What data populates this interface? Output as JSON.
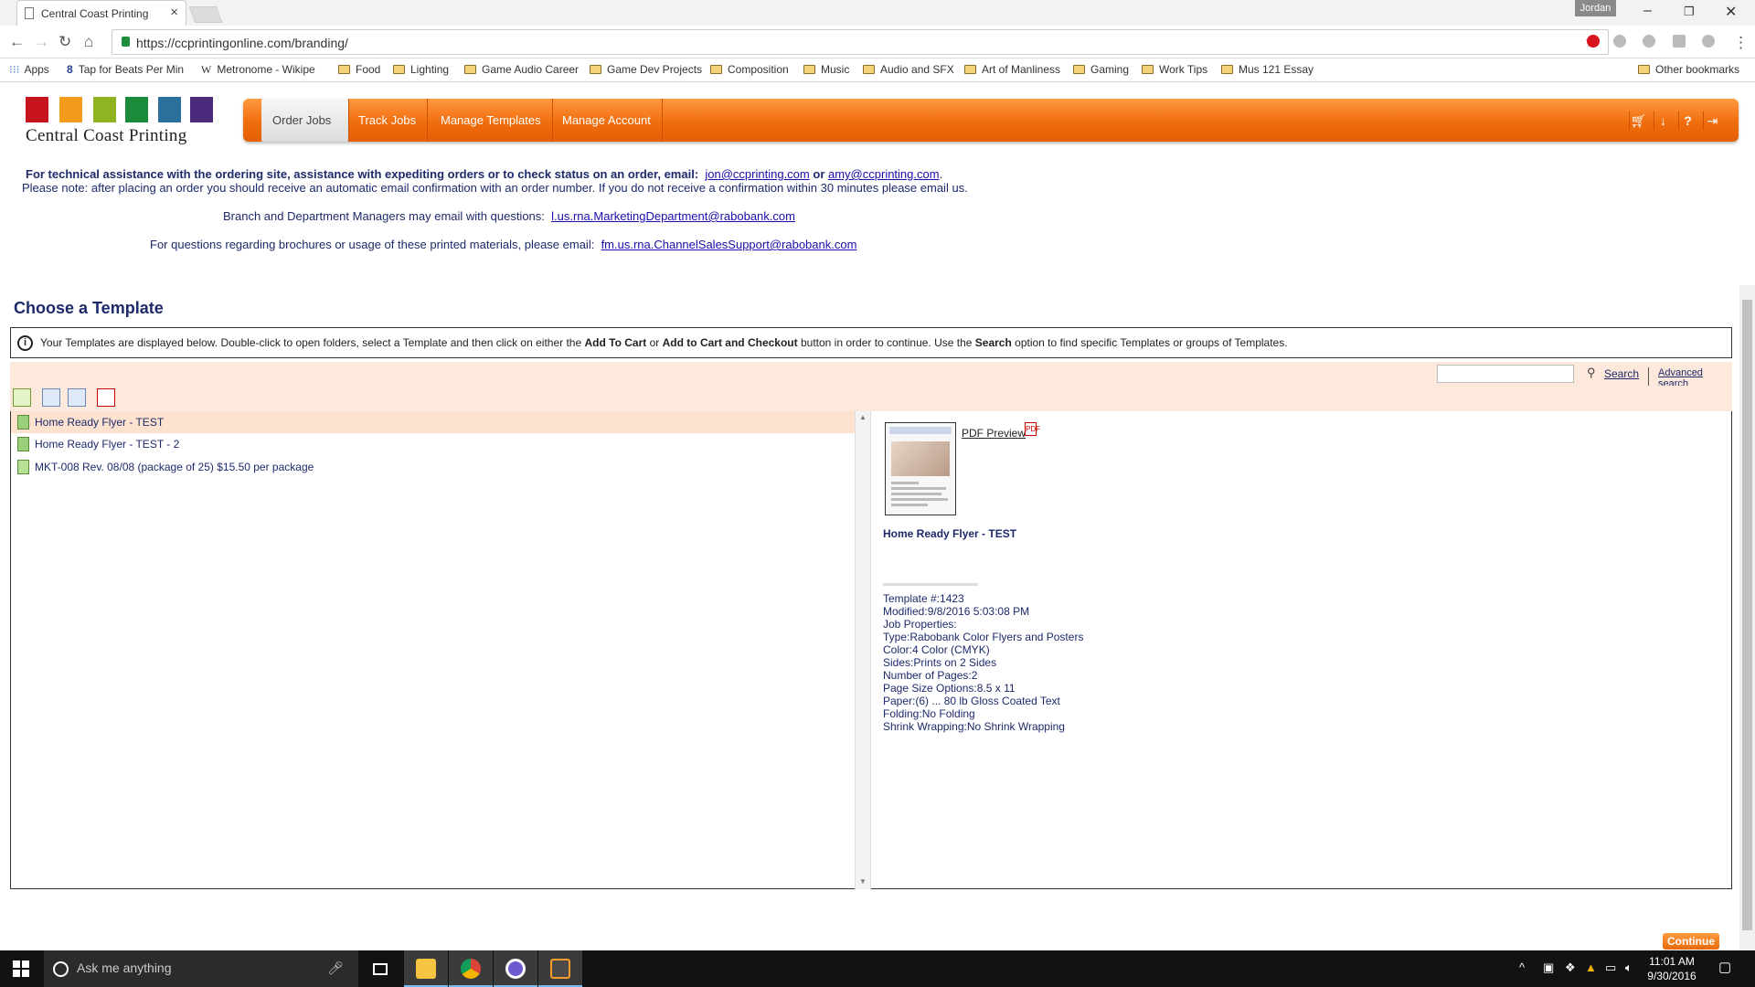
{
  "browser": {
    "tab_title": "Central Coast Printing",
    "close_tab": "×",
    "profile_name": "Jordan",
    "url": "https://ccprintingonline.com/branding/",
    "window": {
      "minimize": "–",
      "restore": "❐",
      "close": "✕"
    },
    "bookmarks": [
      {
        "label": "Apps",
        "icon": "apps-icon"
      },
      {
        "label": "Tap for Beats Per Min",
        "icon": "site-icon"
      },
      {
        "label": "Metronome - Wikipe",
        "icon": "wikipedia-icon"
      },
      {
        "label": "Food",
        "icon": "folder-icon"
      },
      {
        "label": "Lighting",
        "icon": "folder-icon"
      },
      {
        "label": "Game Audio Career",
        "icon": "folder-icon"
      },
      {
        "label": "Game Dev Projects",
        "icon": "folder-icon"
      },
      {
        "label": "Composition",
        "icon": "folder-icon"
      },
      {
        "label": "Music",
        "icon": "folder-icon"
      },
      {
        "label": "Audio and SFX",
        "icon": "folder-icon"
      },
      {
        "label": "Art of Manliness",
        "icon": "folder-icon"
      },
      {
        "label": "Gaming",
        "icon": "folder-icon"
      },
      {
        "label": "Work Tips",
        "icon": "folder-icon"
      },
      {
        "label": "Mus 121 Essay",
        "icon": "folder-icon"
      }
    ],
    "other_bookmarks": "Other bookmarks"
  },
  "site": {
    "logo_text": "Central Coast Printing",
    "logo_colors": [
      "#c8141e",
      "#f39a1b",
      "#8fb321",
      "#1b8a3a",
      "#2d6f9c",
      "#4b2a7c"
    ],
    "accent_color": "#f07a17",
    "menu": [
      "Order Jobs",
      "Track Jobs",
      "Manage Templates",
      "Manage Account"
    ],
    "active_menu": "Order Jobs",
    "menu_icons": [
      "cart-icon",
      "download-icon",
      "help-icon",
      "logout-icon"
    ]
  },
  "info": {
    "line1_text": "For technical assistance with the ordering site, assistance with expediting orders or to check status on an order, email:",
    "email1": "jon@ccprinting.com",
    "or": "or",
    "email2": "amy@ccprinting.com",
    "line2": "Please note: after placing an order you should receive an automatic email confirmation with an order number. If you do not receive a confirmation within 30 minutes please email us.",
    "line3_text": "Branch and Department Managers may email with questions:",
    "email3": "l.us.rna.MarketingDepartment@rabobank.com",
    "line4_text": "For questions regarding brochures or usage of these printed materials, please email:",
    "email4": "fm.us.rna.ChannelSalesSupport@rabobank.com"
  },
  "main": {
    "heading": "Choose a Template",
    "notice_a": "Your Templates are displayed below. Double-click to open folders, select a Template and then click on either the",
    "notice_b1": "Add To Cart",
    "notice_or": "or",
    "notice_b2": "Add to Cart and Checkout",
    "notice_c": "button in order to continue. Use the",
    "notice_b3": "Search",
    "notice_d": "option to find specific Templates or groups of Templates.",
    "search_label": "Search",
    "advanced_search": "Advanced search",
    "templates": [
      {
        "name": "Home Ready Flyer - TEST",
        "selected": true
      },
      {
        "name": "Home Ready Flyer - TEST - 2",
        "selected": false
      },
      {
        "name": "MKT-008 Rev. 08/08 (package of 25) $15.50 per package",
        "selected": false
      }
    ]
  },
  "detail": {
    "pdf_preview": "PDF Preview",
    "name": "Home Ready Flyer - TEST",
    "properties": [
      "Template #:1423",
      "Modified:9/8/2016 5:03:08 PM",
      "Job Properties:",
      "Type:Rabobank Color Flyers and Posters",
      "Color:4 Color (CMYK)",
      "Sides:Prints on 2 Sides",
      "Number of Pages:2",
      "Page Size Options:8.5 x 11",
      "Paper:(6) ... 80 lb Gloss Coated Text",
      "Folding:No Folding",
      "Shrink Wrapping:No Shrink Wrapping"
    ]
  },
  "continue_label": "Continue",
  "taskbar": {
    "search_placeholder": "Ask me anything",
    "time": "11:01 AM",
    "date": "9/30/2016"
  }
}
